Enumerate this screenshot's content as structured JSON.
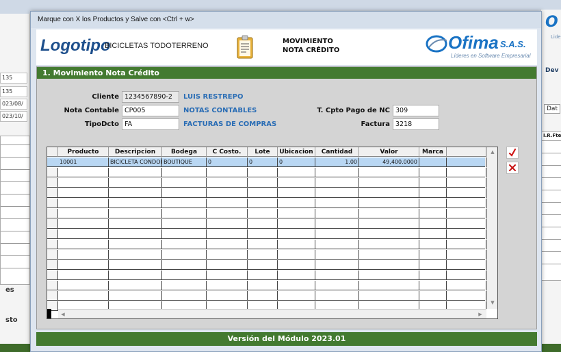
{
  "window": {
    "title": "Marque con X los Productos y Salve con <Ctrl + w>"
  },
  "header": {
    "logo_text": "Logotipo",
    "company_name": "BICICLETAS TODOTERRENO",
    "doc_title_line1": "MOVIMIENTO",
    "doc_title_line2": "NOTA CRÉDITO",
    "brand": {
      "name": "Ofima",
      "suffix": "S.A.S.",
      "tagline": "Líderes en Software Empresarial",
      "color": "#1a73c4"
    }
  },
  "section": {
    "title": "1. Movimiento Nota Crédito",
    "accent_color": "#437a30"
  },
  "form": {
    "cliente_label": "Cliente",
    "cliente_value": "1234567890-2",
    "cliente_desc": "LUIS RESTREPO",
    "nota_label": "Nota Contable",
    "nota_value": "CP005",
    "nota_desc": "NOTAS CONTABLES",
    "tipodcto_label": "TipoDcto",
    "tipodcto_value": "FA",
    "tipodcto_desc": "FACTURAS DE COMPRAS",
    "tcpto_label": "T. Cpto Pago de NC",
    "tcpto_value": "309",
    "factura_label": "Factura",
    "factura_value": "3218"
  },
  "grid": {
    "columns": [
      "Producto",
      "Descripcion",
      "Bodega",
      "C Costo.",
      "Lote",
      "Ubicacion",
      "Cantidad",
      "Valor",
      "Marca"
    ],
    "rows": [
      [
        "10001",
        "BICICLETA CONDOR",
        "BOUTIQUE",
        "0",
        "0",
        "0",
        "1.00",
        "49,400.0000",
        ""
      ]
    ],
    "empty_rows": 14
  },
  "side_buttons": {
    "check_icon": "check-mark-icon",
    "delete_icon": "delete-x-icon"
  },
  "footer": {
    "version": "Versión del Módulo 2023.01"
  },
  "background": {
    "left_fields": [
      "135",
      "135",
      "023/08/",
      "023/10/"
    ],
    "left_label_1": "es",
    "left_label_2": "sto",
    "right_text_1": "Dev",
    "right_text_2": "Dat",
    "right_col": "I.R.Fte",
    "right_logo": "O",
    "right_logo_tag": "Lide",
    "bottom_strip": "Versión del Módulo 2023.01"
  }
}
